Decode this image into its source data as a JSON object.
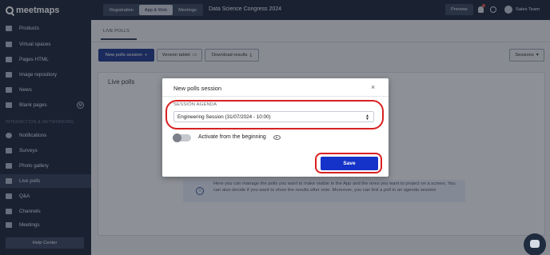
{
  "app": {
    "logo_text": "meetmaps"
  },
  "sidebar": {
    "items": [
      {
        "label": "Products"
      },
      {
        "label": "Virtual spaces"
      },
      {
        "label": "Pages HTML"
      },
      {
        "label": "Image repository"
      },
      {
        "label": "News"
      },
      {
        "label": "Blank pages",
        "badge": "M"
      },
      {
        "label": "Notifications"
      },
      {
        "label": "Surveys"
      },
      {
        "label": "Photo gallery"
      },
      {
        "label": "Live polls"
      },
      {
        "label": "Q&A"
      },
      {
        "label": "Channels"
      },
      {
        "label": "Meetings"
      }
    ],
    "section_label": "INTERACTION & NETWORKING",
    "active_item": "Live polls",
    "help_center_label": "Help Center"
  },
  "topbar": {
    "tabs": [
      "Registration",
      "App & Web",
      "Meetings"
    ],
    "active_tab": "App & Web",
    "event_title": "Data Science Congress 2024",
    "preview_label": "Preview",
    "user_name": "Sales Team"
  },
  "content": {
    "subtab_label": "LIVE POLLS",
    "new_session_label": "New polls session",
    "version_tablet_label": "Version tablet",
    "download_results_label": "Download results",
    "sessions_label": "Sessions",
    "panel_title": "Live polls",
    "info_text": "Here you can manage the polls you want to make visible in the App and the ones you want to project on a screen. You can also decide if you want to show the results after vote. Moreover, you can link a poll in an agenda session"
  },
  "modal": {
    "title": "New polls session",
    "close_glyph": "×",
    "field_label": "SESSIÓN AGENDA",
    "selected_session": "Engineering Session (31/07/2024 - 10:00)",
    "toggle_label": "Activate from the beginning",
    "toggle_on": false,
    "save_label": "Save"
  },
  "colors": {
    "sidebar_bg": "#1f2b3f",
    "primary": "#1f3b8a",
    "save_button": "#1533c9",
    "highlight": "#d92020"
  }
}
